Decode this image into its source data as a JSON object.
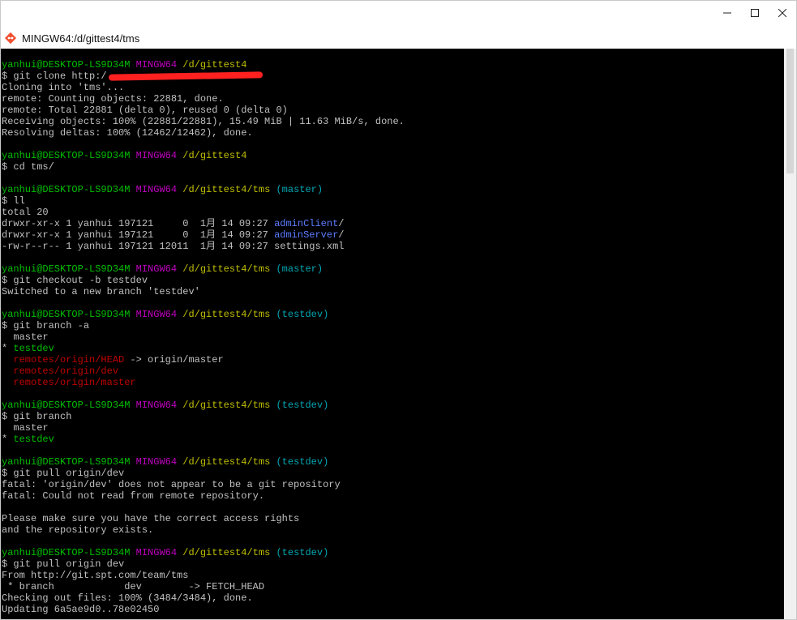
{
  "window": {
    "title": "MINGW64:/d/gittest4/tms",
    "minimize_glyph": "—",
    "maximize_glyph": "☐",
    "close_glyph": "✕"
  },
  "icons": {
    "app": "git-diamond-icon"
  },
  "colors": {
    "user": "#00bf00",
    "env": "#bf00bf",
    "path": "#bfbf00",
    "branch": "#00a6b2",
    "dir": "#5c7cff",
    "remote": "#bf0000",
    "text": "#c0c0c0",
    "redaction": "#ff2020"
  },
  "terminal": {
    "lines": [
      [
        {
          "t": "yanhui@DESKTOP-LS9D34M ",
          "c": "u"
        },
        {
          "t": "MINGW64 ",
          "c": "m"
        },
        {
          "t": "/d/gittest4",
          "c": "y"
        }
      ],
      [
        {
          "t": "$ git clone http:/"
        },
        {
          "t": "",
          "c": "redact"
        }
      ],
      [
        {
          "t": "Cloning into 'tms'..."
        }
      ],
      [
        {
          "t": "remote: Counting objects: 22881, done."
        }
      ],
      [
        {
          "t": "remote: Total 22881 (delta 0), reused 0 (delta 0)"
        }
      ],
      [
        {
          "t": "Receiving objects: 100% (22881/22881), 15.49 MiB | 11.63 MiB/s, done."
        }
      ],
      [
        {
          "t": "Resolving deltas: 100% (12462/12462), done."
        }
      ],
      [
        {
          "t": ""
        }
      ],
      [
        {
          "t": "yanhui@DESKTOP-LS9D34M ",
          "c": "u"
        },
        {
          "t": "MINGW64 ",
          "c": "m"
        },
        {
          "t": "/d/gittest4",
          "c": "y"
        }
      ],
      [
        {
          "t": "$ cd tms/"
        }
      ],
      [
        {
          "t": ""
        }
      ],
      [
        {
          "t": "yanhui@DESKTOP-LS9D34M ",
          "c": "u"
        },
        {
          "t": "MINGW64 ",
          "c": "m"
        },
        {
          "t": "/d/gittest4/tms ",
          "c": "y"
        },
        {
          "t": "(master)",
          "c": "c"
        }
      ],
      [
        {
          "t": "$ ll"
        }
      ],
      [
        {
          "t": "total 20"
        }
      ],
      [
        {
          "t": "drwxr-xr-x 1 yanhui 197121     0  1月 14 09:27 "
        },
        {
          "t": "adminClient",
          "c": "b"
        },
        {
          "t": "/"
        }
      ],
      [
        {
          "t": "drwxr-xr-x 1 yanhui 197121     0  1月 14 09:27 "
        },
        {
          "t": "adminServer",
          "c": "b"
        },
        {
          "t": "/"
        }
      ],
      [
        {
          "t": "-rw-r--r-- 1 yanhui 197121 12011  1月 14 09:27 settings.xml"
        }
      ],
      [
        {
          "t": ""
        }
      ],
      [
        {
          "t": "yanhui@DESKTOP-LS9D34M ",
          "c": "u"
        },
        {
          "t": "MINGW64 ",
          "c": "m"
        },
        {
          "t": "/d/gittest4/tms ",
          "c": "y"
        },
        {
          "t": "(master)",
          "c": "c"
        }
      ],
      [
        {
          "t": "$ git checkout -b testdev"
        }
      ],
      [
        {
          "t": "Switched to a new branch 'testdev'"
        }
      ],
      [
        {
          "t": ""
        }
      ],
      [
        {
          "t": "yanhui@DESKTOP-LS9D34M ",
          "c": "u"
        },
        {
          "t": "MINGW64 ",
          "c": "m"
        },
        {
          "t": "/d/gittest4/tms ",
          "c": "y"
        },
        {
          "t": "(testdev)",
          "c": "c"
        }
      ],
      [
        {
          "t": "$ git branch -a"
        }
      ],
      [
        {
          "t": "  master"
        }
      ],
      [
        {
          "t": "* "
        },
        {
          "t": "testdev",
          "c": "gr"
        }
      ],
      [
        {
          "t": "  "
        },
        {
          "t": "remotes/origin/HEAD",
          "c": "r"
        },
        {
          "t": " -> origin/master"
        }
      ],
      [
        {
          "t": "  "
        },
        {
          "t": "remotes/origin/dev",
          "c": "r"
        }
      ],
      [
        {
          "t": "  "
        },
        {
          "t": "remotes/origin/master",
          "c": "r"
        }
      ],
      [
        {
          "t": ""
        }
      ],
      [
        {
          "t": "yanhui@DESKTOP-LS9D34M ",
          "c": "u"
        },
        {
          "t": "MINGW64 ",
          "c": "m"
        },
        {
          "t": "/d/gittest4/tms ",
          "c": "y"
        },
        {
          "t": "(testdev)",
          "c": "c"
        }
      ],
      [
        {
          "t": "$ git branch"
        }
      ],
      [
        {
          "t": "  master"
        }
      ],
      [
        {
          "t": "* "
        },
        {
          "t": "testdev",
          "c": "gr"
        }
      ],
      [
        {
          "t": ""
        }
      ],
      [
        {
          "t": "yanhui@DESKTOP-LS9D34M ",
          "c": "u"
        },
        {
          "t": "MINGW64 ",
          "c": "m"
        },
        {
          "t": "/d/gittest4/tms ",
          "c": "y"
        },
        {
          "t": "(testdev)",
          "c": "c"
        }
      ],
      [
        {
          "t": "$ git pull origin/dev"
        }
      ],
      [
        {
          "t": "fatal: 'origin/dev' does not appear to be a git repository"
        }
      ],
      [
        {
          "t": "fatal: Could not read from remote repository."
        }
      ],
      [
        {
          "t": ""
        }
      ],
      [
        {
          "t": "Please make sure you have the correct access rights"
        }
      ],
      [
        {
          "t": "and the repository exists."
        }
      ],
      [
        {
          "t": ""
        }
      ],
      [
        {
          "t": "yanhui@DESKTOP-LS9D34M ",
          "c": "u"
        },
        {
          "t": "MINGW64 ",
          "c": "m"
        },
        {
          "t": "/d/gittest4/tms ",
          "c": "y"
        },
        {
          "t": "(testdev)",
          "c": "c"
        }
      ],
      [
        {
          "t": "$ git pull origin dev"
        }
      ],
      [
        {
          "t": "From http://git.spt.com/team/tms"
        }
      ],
      [
        {
          "t": " * branch            dev        -> FETCH_HEAD"
        }
      ],
      [
        {
          "t": "Checking out files: 100% (3484/3484), done."
        }
      ],
      [
        {
          "t": "Updating 6a5ae9d0..78e02450"
        }
      ]
    ]
  }
}
